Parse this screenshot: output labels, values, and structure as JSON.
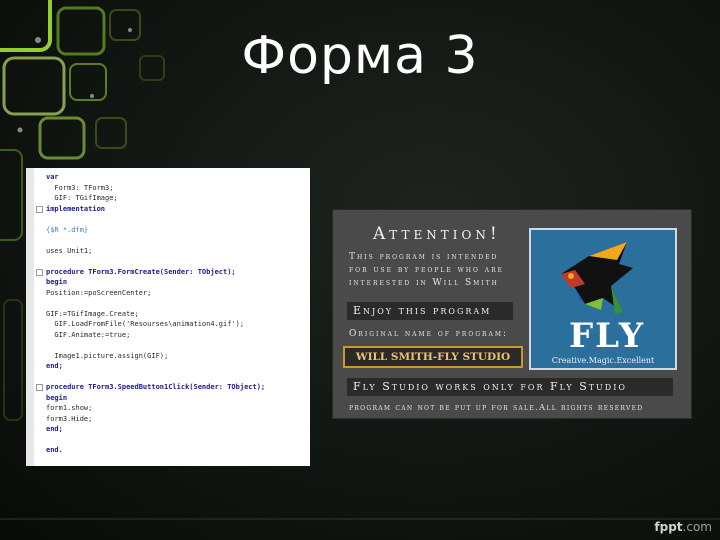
{
  "slide": {
    "title": "Форма 3",
    "watermark": {
      "brand": "fppt",
      "suffix": ".com"
    }
  },
  "code_image": {
    "lines": [
      {
        "text": "var",
        "style": "kw"
      },
      {
        "text": "  Form3: TForm3;",
        "style": ""
      },
      {
        "text": "  GIF: TGifImage;",
        "style": ""
      },
      {
        "text": "implementation",
        "style": "kw"
      },
      {
        "text": "",
        "style": ""
      },
      {
        "text": "{$R *.dfm}",
        "style": "cm"
      },
      {
        "text": "",
        "style": ""
      },
      {
        "text": "uses Unit1;",
        "style": ""
      },
      {
        "text": "",
        "style": ""
      },
      {
        "text": "procedure TForm3.FormCreate(Sender: TObject);",
        "style": "kw"
      },
      {
        "text": "begin",
        "style": "kw"
      },
      {
        "text": "Position:=poScreenCenter;",
        "style": ""
      },
      {
        "text": "",
        "style": ""
      },
      {
        "text": "GIF:=TGifImage.Create;",
        "style": ""
      },
      {
        "text": "  GIF.LoadFromFile('Resourses\\animation4.gif');",
        "style": ""
      },
      {
        "text": "  GIF.Animate:=true;",
        "style": ""
      },
      {
        "text": "",
        "style": ""
      },
      {
        "text": "  Image1.picture.assign(GIF);",
        "style": ""
      },
      {
        "text": "end;",
        "style": "kw"
      },
      {
        "text": "",
        "style": ""
      },
      {
        "text": "procedure TForm3.SpeedButton1Click(Sender: TObject);",
        "style": "kw"
      },
      {
        "text": "begin",
        "style": "kw"
      },
      {
        "text": "form1.show;",
        "style": ""
      },
      {
        "text": "form3.Hide;",
        "style": ""
      },
      {
        "text": "end;",
        "style": "kw"
      },
      {
        "text": "",
        "style": ""
      },
      {
        "text": "end.",
        "style": "kw"
      }
    ]
  },
  "attention_image": {
    "title": "Attention!",
    "intro_lines": [
      "This program is intended",
      "for use by people who are",
      "interested in Will Smith"
    ],
    "enjoy": "Enjoy this program",
    "original_name_label": "Original name of program:",
    "program_name": "WILL SMITH-FLY STUDIO",
    "works_only": "Fly Studio works only for Fly Studio",
    "rights": "program can not be put up for sale.All rights reserved",
    "logo": {
      "word": "FLY",
      "tagline": "Creative.Magic.Excellent"
    }
  },
  "colors": {
    "background": "#111511",
    "accent_green": "#8bc34a",
    "accent_gold": "#c59a2e",
    "logo_blue": "#2b6f9c"
  }
}
